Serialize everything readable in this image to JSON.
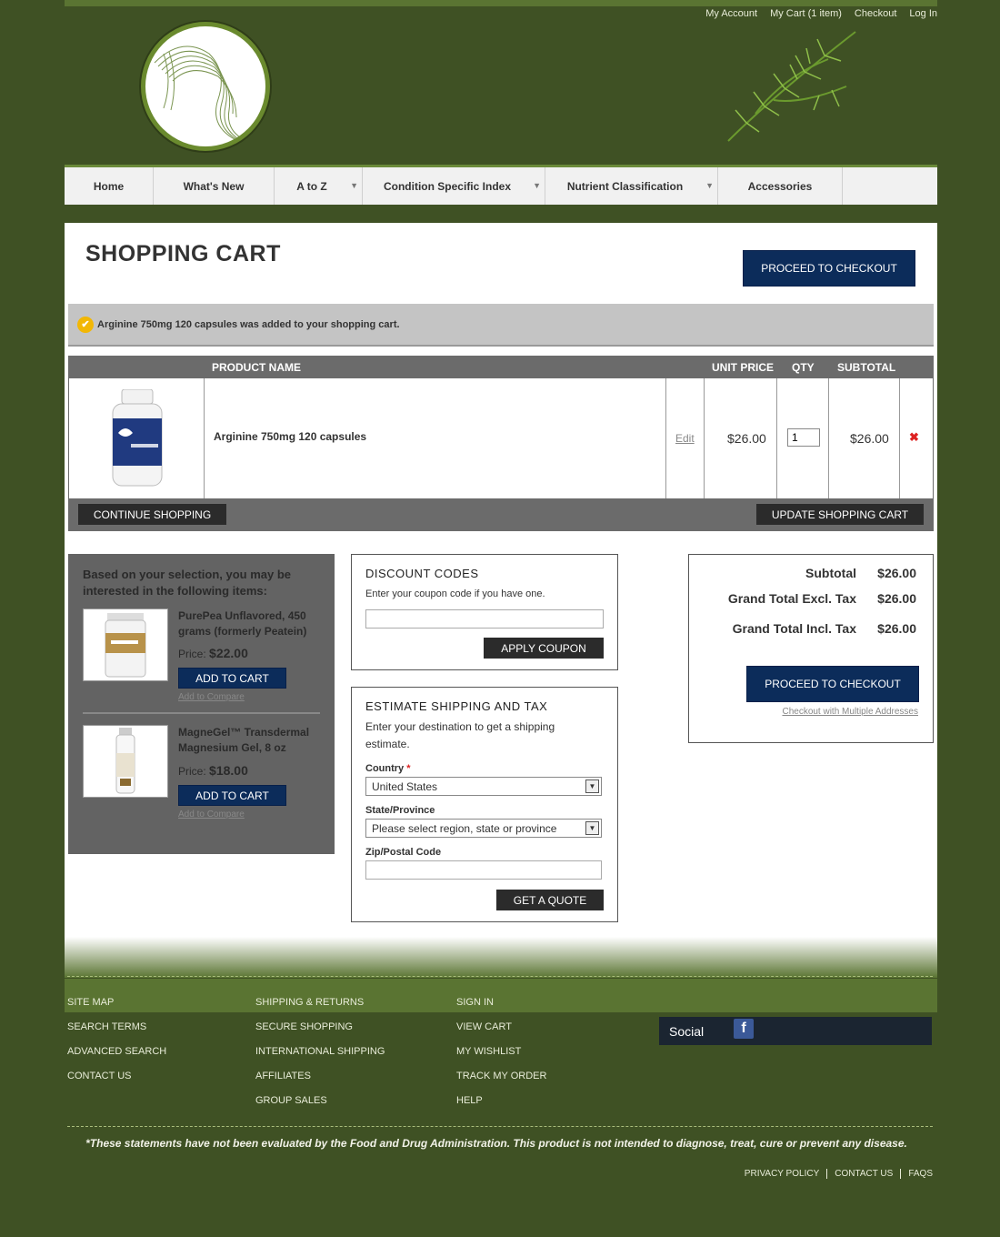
{
  "toplinks": [
    "My Account",
    "My Cart (1 item)",
    "Checkout",
    "Log In"
  ],
  "nav": [
    {
      "label": "Home",
      "dropdown": false
    },
    {
      "label": "What's New",
      "dropdown": false
    },
    {
      "label": "A to Z",
      "dropdown": true
    },
    {
      "label": "Condition Specific Index",
      "dropdown": true
    },
    {
      "label": "Nutrient Classification",
      "dropdown": true
    },
    {
      "label": "Accessories",
      "dropdown": false
    }
  ],
  "page_title": "SHOPPING CART",
  "checkout_top": "PROCEED TO CHECKOUT",
  "success_message": "Arginine 750mg 120 capsules was added to your shopping cart.",
  "cart": {
    "headers": {
      "product": "PRODUCT NAME",
      "unit_price": "UNIT PRICE",
      "qty": "QTY",
      "subtotal": "SUBTOTAL"
    },
    "item": {
      "name": "Arginine 750mg 120 capsules",
      "edit": "Edit",
      "unit_price": "$26.00",
      "qty": "1",
      "subtotal": "$26.00",
      "remove_icon": "remove-x-icon"
    },
    "continue": "CONTINUE SHOPPING",
    "update": "UPDATE SHOPPING CART"
  },
  "related": {
    "intro": "Based on your selection, you may be interested in the following items:",
    "items": [
      {
        "name": "PurePea Unflavored, 450 grams (formerly Peatein)",
        "price_label": "Price:",
        "price": "$22.00",
        "add": "ADD TO CART",
        "compare": "Add to Compare"
      },
      {
        "name": "MagneGel™ Transdermal Magnesium Gel, 8 oz",
        "price_label": "Price:",
        "price": "$18.00",
        "add": "ADD TO CART",
        "compare": "Add to Compare"
      }
    ]
  },
  "discount": {
    "title": "DISCOUNT CODES",
    "hint": "Enter your coupon code if you have one.",
    "value": "",
    "button": "APPLY COUPON"
  },
  "shipping": {
    "title": "ESTIMATE SHIPPING AND TAX",
    "hint_line1": "Enter your destination to get a shipping",
    "hint_line2": "estimate.",
    "country_label": "Country",
    "required_mark": "*",
    "country_value": "United States",
    "region_label": "State/Province",
    "region_value": "Please select region, state or province",
    "zip_label": "Zip/Postal Code",
    "zip_value": "",
    "button": "GET A QUOTE"
  },
  "totals": {
    "rows": [
      {
        "label": "Subtotal",
        "value": "$26.00"
      },
      {
        "label": "Grand Total Excl. Tax",
        "value": "$26.00"
      },
      {
        "label": "Grand Total Incl. Tax",
        "value": "$26.00"
      }
    ],
    "checkout": "PROCEED TO CHECKOUT",
    "multi": "Checkout with Multiple Addresses"
  },
  "footer": {
    "col1": [
      "SITE MAP",
      "SEARCH TERMS",
      "ADVANCED SEARCH",
      "CONTACT US"
    ],
    "col2": [
      "SHIPPING & RETURNS",
      "SECURE SHOPPING",
      "INTERNATIONAL SHIPPING",
      "AFFILIATES",
      "GROUP SALES"
    ],
    "col3": [
      "SIGN IN",
      "VIEW CART",
      "MY WISHLIST",
      "TRACK MY ORDER",
      "HELP"
    ],
    "social_label": "Social",
    "disclaimer": "*These statements have not been evaluated by the Food and Drug Administration. This product is not intended to diagnose, treat, cure or prevent any disease.",
    "legal": [
      "PRIVACY POLICY",
      "CONTACT US",
      "FAQS"
    ]
  },
  "colors": {
    "navy": "#0c2c5a",
    "olive": "#3f5124",
    "band": "#5a7432"
  }
}
